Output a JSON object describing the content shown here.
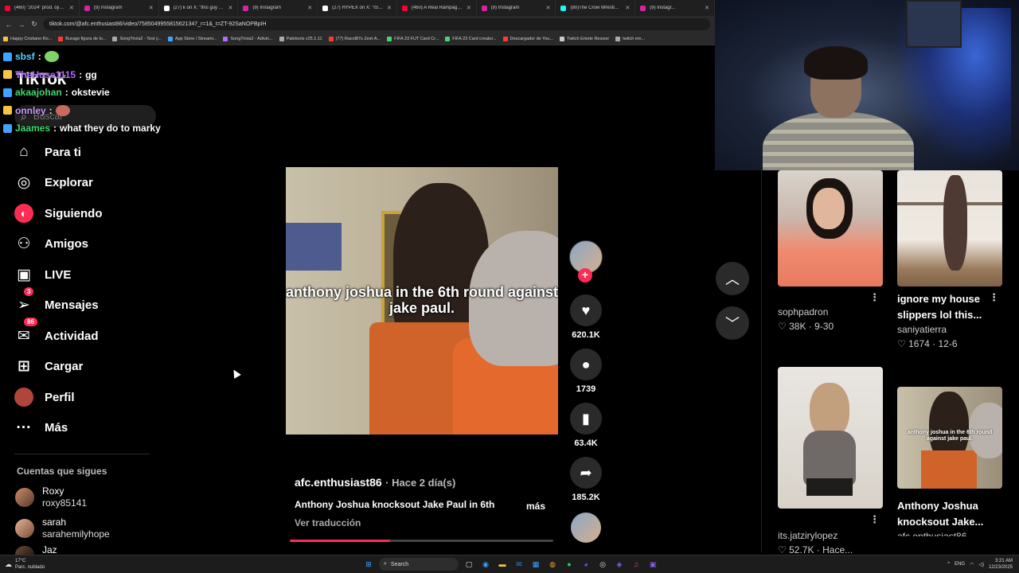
{
  "browser": {
    "tabs": [
      {
        "title": "(460) \"2024\" prod. ojivolta...",
        "color": "#ff0033"
      },
      {
        "title": "(9) Instagram",
        "color": "#d6249f"
      },
      {
        "title": "(27) k on X: \"this guy gon...",
        "color": "#ffffff"
      },
      {
        "title": "(9) Instagram",
        "color": "#d6249f"
      },
      {
        "title": "(27) HYPEX on X: \"ISHOW...",
        "color": "#ffffff"
      },
      {
        "title": "(460) A Real Rampage Ja...",
        "color": "#ff0033"
      },
      {
        "title": "(9) Instagram",
        "color": "#d6249f"
      },
      {
        "title": "(80)The Crow Wrestler S...",
        "color": "#25f4ee"
      },
      {
        "title": "(9) Instagr...",
        "color": "#d6249f"
      }
    ],
    "url": "tiktok.com/@afc.enthusiast86/video/7585049955815621347_r=1&_t=ZT-92SaNOPBpIH",
    "bookmarks": [
      "Happy Cristiano Ro...",
      "Burago figura de lo...",
      "SongTrivia2 - Test y...",
      "App Store / Streami...",
      "SongTrivia2 - Adivin...",
      "Paletools v25.1.11",
      "(77) Racol87s Zest-A...",
      "FIFA 23 FUT Card Cr...",
      "FIFA 23 Card creator...",
      "Descargador de You...",
      "Twitch Emote Resizer",
      "twitch em..."
    ]
  },
  "chat": [
    {
      "user": "sbsf",
      "message": "",
      "color": "#4fd1ff",
      "emote": true
    },
    {
      "user": "TheHuse1115",
      "message": "gg",
      "color": "#b36bff",
      "emote": false
    },
    {
      "user": "akaajohan",
      "message": "okstevie",
      "color": "#3fd96f",
      "emote": false
    },
    {
      "user": "onnley",
      "message": "",
      "color": "#c89bff",
      "emote": true
    },
    {
      "user": "Jaames",
      "message": "what they do to marky",
      "color": "#3fd96f",
      "emote": false
    }
  ],
  "sidebar": {
    "logo": "TikTok",
    "search_placeholder": "Buscar",
    "items": [
      {
        "label": "Para ti",
        "icon": "⌂",
        "badge": ""
      },
      {
        "label": "Explorar",
        "icon": "◎",
        "badge": ""
      },
      {
        "label": "Siguiendo",
        "icon": "◐",
        "badge": ""
      },
      {
        "label": "Amigos",
        "icon": "⚇",
        "badge": ""
      },
      {
        "label": "LIVE",
        "icon": "▣",
        "badge": ""
      },
      {
        "label": "Mensajes",
        "icon": "➢",
        "badge": "3"
      },
      {
        "label": "Actividad",
        "icon": "✉",
        "badge": "86"
      },
      {
        "label": "Cargar",
        "icon": "⊞",
        "badge": ""
      },
      {
        "label": "Perfil",
        "icon": "●",
        "badge": ""
      },
      {
        "label": "Más",
        "icon": "···",
        "badge": ""
      }
    ],
    "following_title": "Cuentas que sigues",
    "following": [
      {
        "name": "Roxy",
        "username": "roxy85141"
      },
      {
        "name": "sarah",
        "username": "sarahemilyhope"
      },
      {
        "name": "Jaz",
        "username": ""
      }
    ]
  },
  "video": {
    "caption": "anthony joshua in the 6th round against jake paul.",
    "author": "afc.enthusiast86",
    "date": "· Hace 2 día(s)",
    "description": "Anthony Joshua knocksout Jake Paul in 6th",
    "more": "más",
    "translate": "Ver traducción",
    "progress": 0.38,
    "likes": "620.1K",
    "comments": "1739",
    "saves": "63.4K",
    "shares": "185.2K"
  },
  "recommended": [
    {
      "title": "",
      "user": "sophpadron",
      "likes": "38K",
      "date": "9-30"
    },
    {
      "title": "ignore my house slippers lol this...",
      "user": "saniyatierra",
      "likes": "1674",
      "date": "12-6"
    },
    {
      "title": "",
      "user": "its.jatzirylopez",
      "likes": "52.7K",
      "date": "Hace..."
    },
    {
      "title": "Anthony Joshua knocksout Jake...",
      "user": "afc.enthusiast86",
      "likes": "",
      "date": "",
      "thumb_caption": "anthony joshua in the 6th round against jake paul."
    }
  ],
  "taskbar": {
    "weather_temp": "17°C",
    "weather_desc": "Parc. nublado",
    "search": "Search",
    "lang": "ENG",
    "time": "3:21 AM",
    "date": "12/23/2025"
  }
}
